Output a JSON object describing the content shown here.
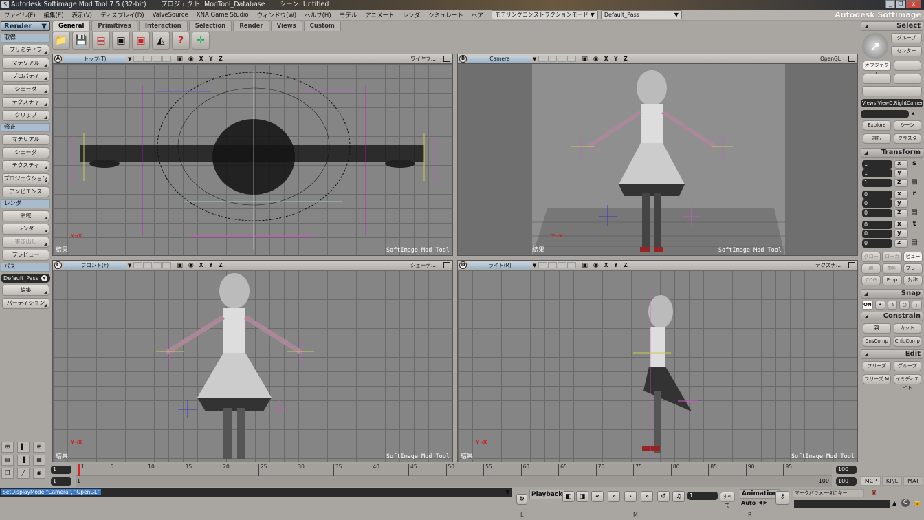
{
  "window": {
    "title": "Autodesk Softimage Mod Tool 7.5 (32-bit)",
    "project": "プロジェクト: ModTool_Database",
    "scene": "シーン: Untitled",
    "brand": "Autodesk Softimage",
    "minimize": "_",
    "restore": "❐",
    "close": "x"
  },
  "menu": [
    "ファイル(F)",
    "編集(E)",
    "表示(V)",
    "ディスプレイ(D)",
    "ValveSource",
    "XNA Game Studio",
    "ウィンドウ(W)",
    "ヘルプ(H)",
    "モデル",
    "アニメート",
    "レンダ",
    "シミュレート",
    "ヘア"
  ],
  "mode_dropdown": "モデリングコンストラクションモード",
  "pass_dropdown": "Default_Pass",
  "render_dropdown": "Render",
  "tabs": [
    {
      "label": "General",
      "active": true
    },
    {
      "label": "Primitives"
    },
    {
      "label": "Interaction"
    },
    {
      "label": "Selection"
    },
    {
      "label": "Render"
    },
    {
      "label": "Views"
    },
    {
      "label": "Custom"
    }
  ],
  "toolbar_icons": [
    "folder-open",
    "save",
    "save-as",
    "duplicate",
    "clone",
    "primitive-shapes",
    "unknown-object",
    "transform-axis"
  ],
  "left_panel": {
    "sections": [
      {
        "title": "取得",
        "buttons": [
          {
            "label": "プリミティブ"
          },
          {
            "label": "マテリアル"
          },
          {
            "label": "プロパティ"
          },
          {
            "label": "シェーダ"
          },
          {
            "label": "テクスチャ"
          },
          {
            "label": "クリップ"
          }
        ]
      },
      {
        "title": "修正",
        "buttons": [
          {
            "label": "マテリアル"
          },
          {
            "label": "シェーダ"
          },
          {
            "label": "テクスチャ"
          },
          {
            "label": "プロジェクション"
          },
          {
            "label": "アンビエンス"
          }
        ]
      },
      {
        "title": "レンダ",
        "buttons": [
          {
            "label": "領域"
          },
          {
            "label": "レンダ"
          },
          {
            "label": "書き出し",
            "disabled": true
          },
          {
            "label": "プレビュー"
          }
        ]
      },
      {
        "title": "パス",
        "pass_value": "Default_Pass",
        "buttons": [
          {
            "label": "編集"
          },
          {
            "label": "パーティション"
          }
        ]
      }
    ]
  },
  "viewports": [
    {
      "letter": "A",
      "name": "トップ(T)",
      "mode": "ワイヤフ...",
      "result": "結果",
      "watermark": "SoftImage Mod Tool"
    },
    {
      "letter": "B",
      "name": "Camera",
      "mode": "OpenGL",
      "result": "結果",
      "watermark": "SoftImage Mod Tool"
    },
    {
      "letter": "C",
      "name": "フロント(F)",
      "mode": "シェーデ...",
      "result": "結果",
      "watermark": "SoftImage Mod Tool"
    },
    {
      "letter": "D",
      "name": "ライト(R)",
      "mode": "テクスチ...",
      "result": "結果",
      "watermark": "SoftImage Mod Tool"
    }
  ],
  "viewport_xyz": "X Y Z",
  "right_panel": {
    "select": {
      "title": "Select",
      "buttons": [
        "グループ",
        "センター",
        "オブジェクト"
      ],
      "selected": "オブジェクト",
      "current": "Views.ViewD.RightCamer",
      "explore": "Explore",
      "scene": "シーン",
      "select_btn": "選択",
      "cluster": "クラスタ"
    },
    "transform": {
      "title": "Transform",
      "scale": [
        "1",
        "1",
        "1"
      ],
      "rotate": [
        "0",
        "0",
        "0"
      ],
      "translate": [
        "0",
        "0",
        "0"
      ],
      "axes": [
        "x",
        "y",
        "z"
      ],
      "side": [
        "s",
        "r",
        "t"
      ],
      "ref": [
        "グローバル",
        "ローカル",
        "ビュー"
      ],
      "ref2": [
        "親",
        "参照",
        "プレーン"
      ],
      "ref3": [
        "COG",
        "Prop",
        "対称"
      ]
    },
    "snap": {
      "title": "Snap",
      "on": "ON"
    },
    "constrain": {
      "title": "Constrain",
      "buttons": [
        "親",
        "カット",
        "CnsComp",
        "ChldComp"
      ]
    },
    "edit": {
      "title": "Edit",
      "buttons": [
        "フリーズ",
        "グループ",
        "フリーズ M",
        "イミディエイト"
      ]
    }
  },
  "timeline": {
    "start": "1",
    "end": "100",
    "current": "1",
    "start2": "1",
    "end2": "100",
    "range_end": "100",
    "ticks": [
      1,
      5,
      10,
      15,
      20,
      25,
      30,
      35,
      40,
      45,
      50,
      55,
      60,
      65,
      70,
      75,
      80,
      85,
      90,
      95
    ]
  },
  "command_line": "SetDisplayMode \"Camera\", \"OpenGL\"",
  "playback": {
    "label": "Playback",
    "frame": "1",
    "all": "すべて",
    "animation": "Animation",
    "auto": "Auto",
    "marker": "マークパラメータにキー"
  },
  "bottom_tabs": [
    "MCP",
    "KP/L",
    "MAT"
  ],
  "lmr": [
    "L",
    "M",
    "R"
  ]
}
